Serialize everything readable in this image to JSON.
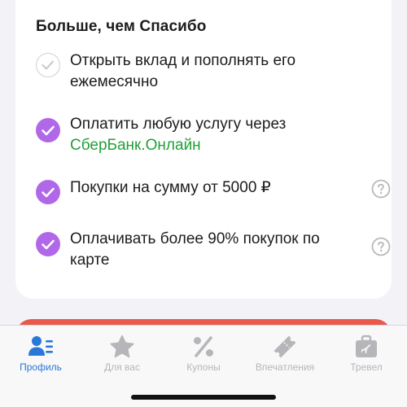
{
  "card": {
    "title": "Больше, чем Спасибо",
    "tasks": [
      {
        "text": "Открыть вклад и пополнять его ежемесячно",
        "link": "",
        "done": false,
        "help": false
      },
      {
        "text": "Оплатить любую услугу через",
        "link": "СберБанк.Онлайн",
        "done": true,
        "help": false
      },
      {
        "text": "Покупки на сумму от 5000 ₽",
        "link": "",
        "done": true,
        "help": true
      },
      {
        "text": "Оплачивать более 90% покупок по карте",
        "link": "",
        "done": true,
        "help": true
      }
    ]
  },
  "tabbar": {
    "tabs": [
      {
        "label": "Профиль",
        "icon": "profile-icon",
        "active": true
      },
      {
        "label": "Для вас",
        "icon": "star-icon",
        "active": false
      },
      {
        "label": "Купоны",
        "icon": "percent-icon",
        "active": false
      },
      {
        "label": "Впечатления",
        "icon": "ticket-icon",
        "active": false
      },
      {
        "label": "Тревел",
        "icon": "suitcase-icon",
        "active": false
      }
    ]
  },
  "colors": {
    "accent_purple": "#b168e8",
    "link_green": "#21a038",
    "active_blue": "#2a78d6",
    "inactive_gray": "#b6b6ba",
    "banner_red": "#e8594b"
  }
}
